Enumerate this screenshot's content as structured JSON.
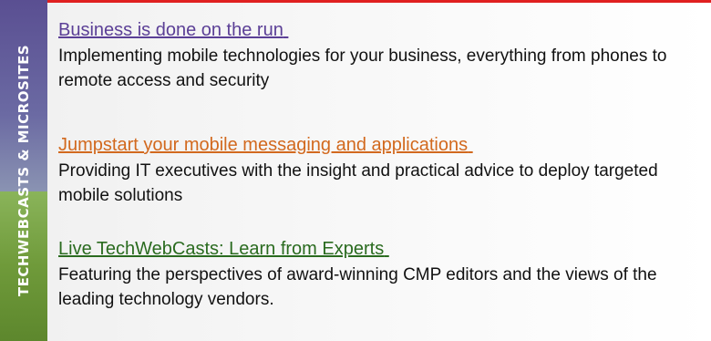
{
  "banner": {
    "text": "TECHWEBCASTS & MICROSITES",
    "colors": {
      "top": "#5a4f92",
      "bottom": "#6f9a3a",
      "rule": "#e02020"
    }
  },
  "items": [
    {
      "title": "Business is done on the run",
      "description": "Implementing mobile technologies for your business, everything from phones to remote access and security",
      "color": "#5b3f96"
    },
    {
      "title": "Jumpstart your mobile messaging and applications",
      "description": "Providing IT executives with the insight and practical advice to deploy targeted mobile solutions",
      "color": "#d2691e"
    },
    {
      "title": "Live TechWebCasts: Learn from Experts",
      "description": "Featuring the perspectives of award-winning CMP editors and the views of the leading technology vendors.",
      "color": "#2a6b1f"
    }
  ]
}
